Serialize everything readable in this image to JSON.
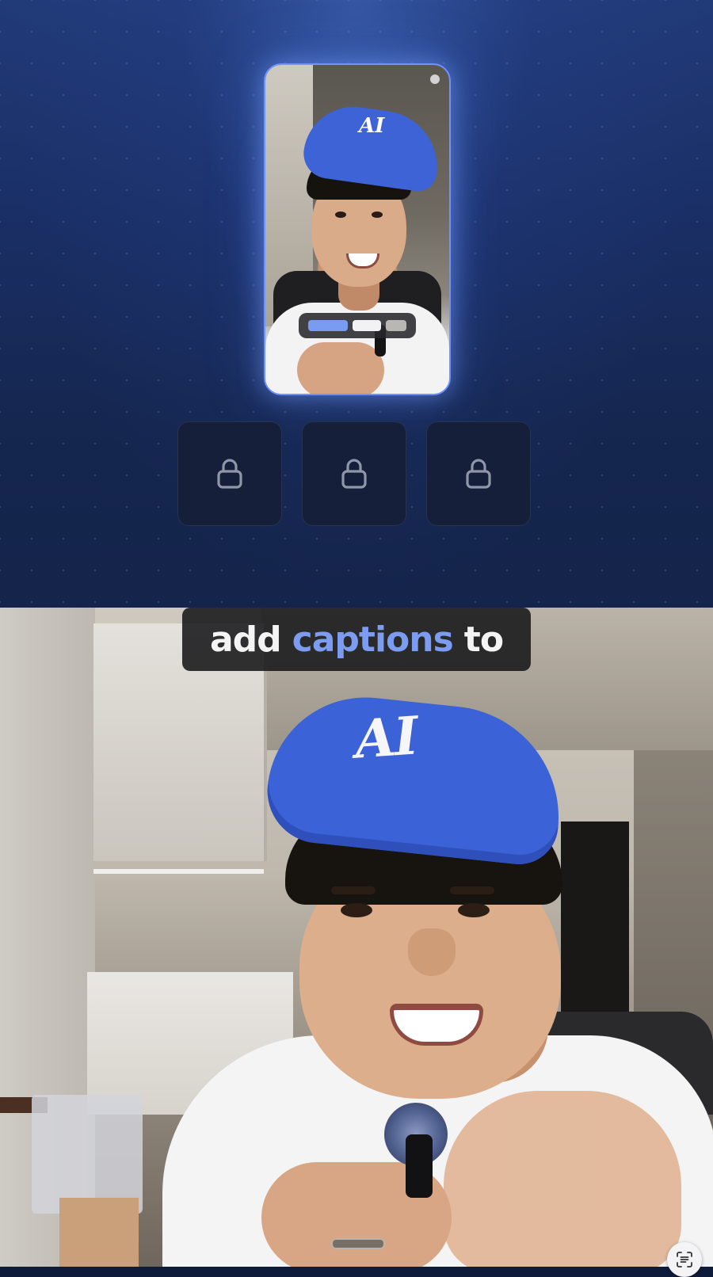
{
  "promo": {
    "preview": {
      "style_swatches": [
        {
          "name": "style-blue",
          "color": "#7a9bf2"
        },
        {
          "name": "style-white",
          "color": "#f2f2f4"
        },
        {
          "name": "style-gray",
          "color": "#b8b7b3"
        }
      ],
      "record_indicator_icon": "dot-icon"
    },
    "locked_options": [
      {
        "icon": "lock-icon"
      },
      {
        "icon": "lock-icon"
      },
      {
        "icon": "lock-icon"
      }
    ]
  },
  "video": {
    "caption": {
      "words": [
        "add",
        "captions",
        "to"
      ],
      "highlighted_index": 1,
      "highlight_color": "#7c9cf2",
      "text_color": "#f4f4f4"
    },
    "cap_logo_text": "AI"
  },
  "system": {
    "scan_button_icon": "text-scan-icon"
  },
  "colors": {
    "accent": "#6f92ff",
    "background_top": "#213a78",
    "background_bottom": "#14244a"
  }
}
